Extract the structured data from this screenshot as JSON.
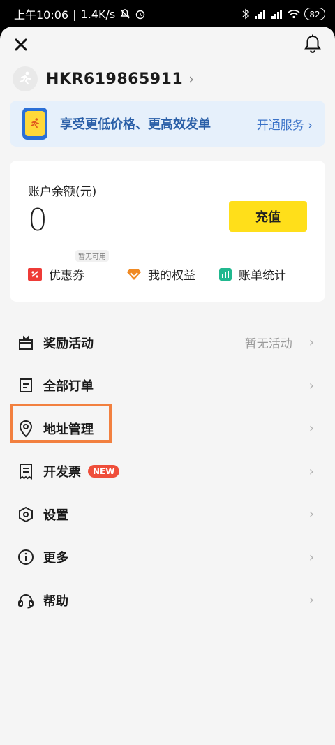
{
  "status_bar": {
    "time": "上午10:06",
    "speed": "1.4K/s",
    "battery": "82"
  },
  "user": {
    "name": "HKR619865911",
    "chevron": "›"
  },
  "promo": {
    "text": "享受更低价格、更高效发单",
    "link": "开通服务 ›"
  },
  "balance": {
    "label": "账户余额(元)",
    "value": "0",
    "recharge_label": "充值"
  },
  "card_actions": {
    "coupons": "优惠券",
    "coupons_badge": "暂无可用",
    "benefits": "我的权益",
    "bill_stats": "账单统计"
  },
  "menu": {
    "rewards": {
      "label": "奖励活动",
      "extra": "暂无活动"
    },
    "orders": {
      "label": "全部订单"
    },
    "address": {
      "label": "地址管理"
    },
    "invoice": {
      "label": "开发票",
      "badge": "NEW"
    },
    "settings": {
      "label": "设置"
    },
    "more": {
      "label": "更多"
    },
    "help": {
      "label": "帮助"
    },
    "chevron": "›"
  },
  "colors": {
    "accent_yellow": "#ffdf1a",
    "promo_bg": "#e6f0fb",
    "highlight": "#f2803f",
    "new_badge": "#ef4e3a"
  }
}
